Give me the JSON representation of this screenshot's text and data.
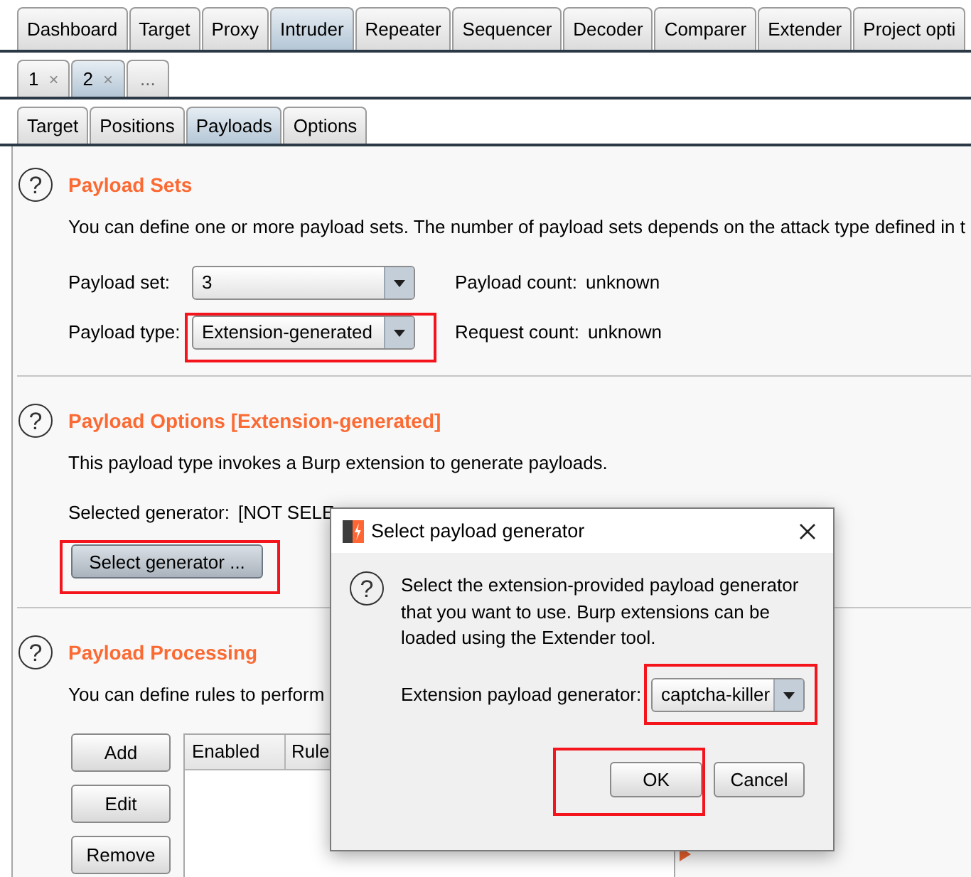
{
  "main_tabs": [
    {
      "label": "Dashboard",
      "selected": false
    },
    {
      "label": "Target",
      "selected": false
    },
    {
      "label": "Proxy",
      "selected": false
    },
    {
      "label": "Intruder",
      "selected": true
    },
    {
      "label": "Repeater",
      "selected": false
    },
    {
      "label": "Sequencer",
      "selected": false
    },
    {
      "label": "Decoder",
      "selected": false
    },
    {
      "label": "Comparer",
      "selected": false
    },
    {
      "label": "Extender",
      "selected": false
    },
    {
      "label": "Project opti",
      "selected": false
    }
  ],
  "attack_tabs": [
    {
      "kind": "session",
      "label": "1",
      "close": "×",
      "selected": false
    },
    {
      "kind": "session",
      "label": "2",
      "close": "×",
      "selected": true
    },
    {
      "kind": "new_tab",
      "label": "...",
      "selected": false
    }
  ],
  "sub_tabs": [
    {
      "label": "Target",
      "selected": false
    },
    {
      "label": "Positions",
      "selected": false
    },
    {
      "label": "Payloads",
      "selected": true
    },
    {
      "label": "Options",
      "selected": false
    }
  ],
  "sections": [
    {
      "kind": "payload_sets",
      "help": "?",
      "title": "Payload Sets",
      "description": "You can define one or more payload sets. The number of payload sets depends on the attack type defined in t",
      "fields": [
        {
          "label": "Payload set:",
          "value": "3",
          "highlighted": false,
          "info_label": "Payload count:",
          "info_value": "unknown"
        },
        {
          "label": "Payload type:",
          "value": "Extension-generated",
          "highlighted": true,
          "info_label": "Request count:",
          "info_value": "unknown"
        }
      ]
    },
    {
      "kind": "payload_options",
      "help": "?",
      "title": "Payload Options [Extension-generated]",
      "description": "This payload type invokes a Burp extension to generate payloads.",
      "generator_label": "Selected generator:",
      "generator_value": "[NOT SELE",
      "button": {
        "label": "Select generator ...",
        "pressed": true,
        "highlighted": true
      }
    },
    {
      "kind": "payload_processing",
      "help": "?",
      "title": "Payload Processing",
      "description": "You can define rules to perform",
      "buttons": [
        "Add",
        "Edit",
        "Remove"
      ],
      "table": {
        "columns": [
          "Enabled",
          "Rule"
        ]
      }
    }
  ],
  "dialog": {
    "title": "Select payload generator",
    "help": "?",
    "message": "Select the extension-provided payload generator that you want to use. Burp extensions can be loaded using the Extender tool.",
    "field_label": "Extension payload generator:",
    "field_value": "captcha-killer",
    "field_highlighted": true,
    "buttons": [
      {
        "label": "OK",
        "highlighted": true
      },
      {
        "label": "Cancel",
        "highlighted": false
      }
    ]
  }
}
